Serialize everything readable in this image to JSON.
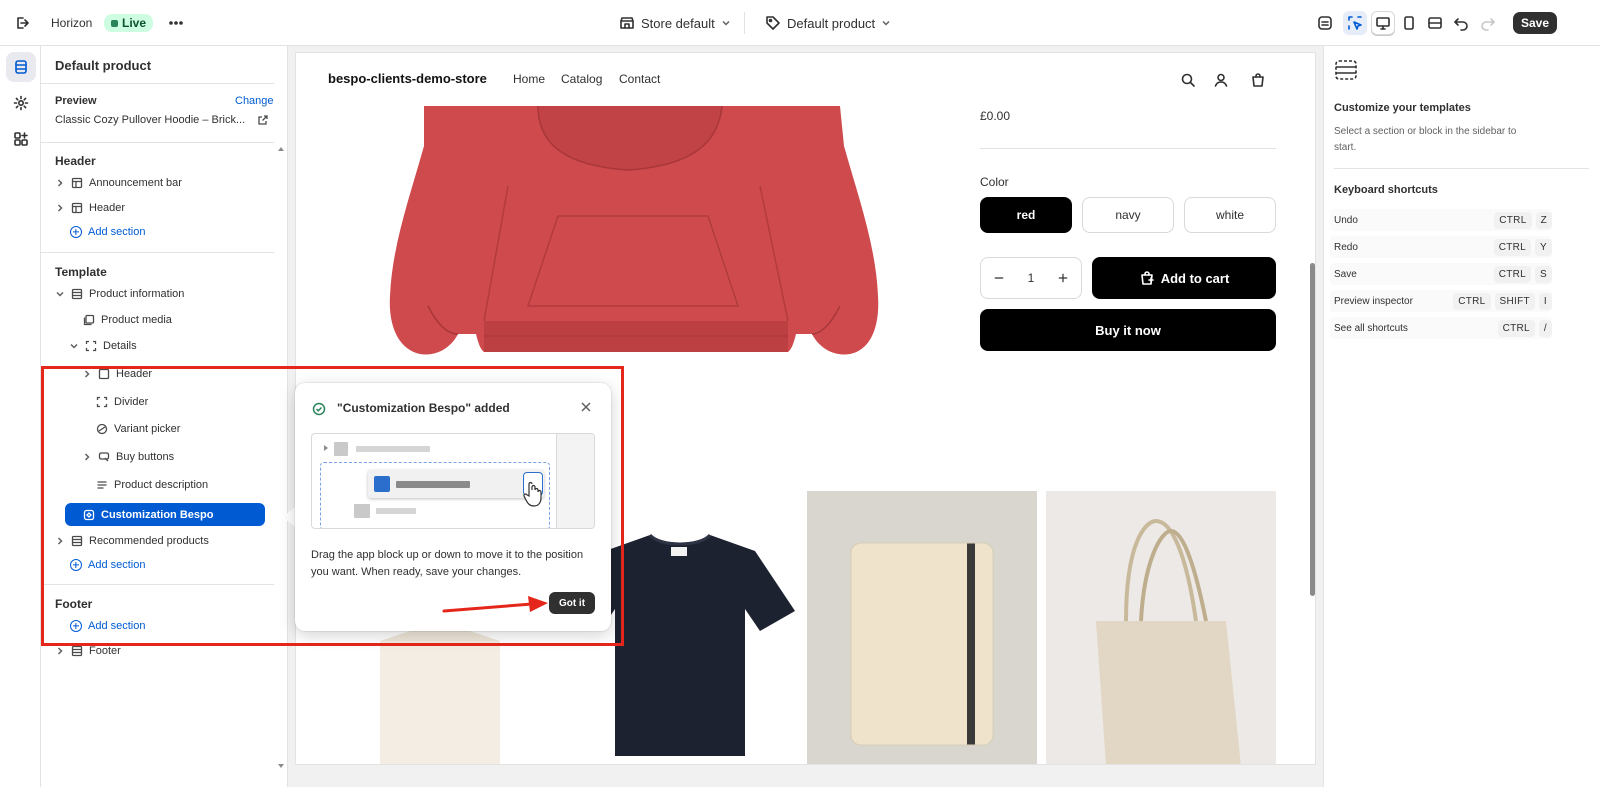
{
  "topbar": {
    "theme_name": "Horizon",
    "live_label": "Live",
    "store_selector": "Store default",
    "template_selector": "Default product",
    "save_label": "Save"
  },
  "sidebar": {
    "title": "Default product",
    "preview_label": "Preview",
    "change_label": "Change",
    "preview_product": "Classic Cozy Pullover Hoodie – Brick...",
    "header_group": "Header",
    "header_items": [
      "Announcement bar",
      "Header"
    ],
    "add_section": "Add section",
    "template_group": "Template",
    "product_information": "Product information",
    "product_media": "Product media",
    "details": "Details",
    "details_header": "Header",
    "divider": "Divider",
    "variant_picker": "Variant picker",
    "buy_buttons": "Buy buttons",
    "product_description": "Product description",
    "customization": "Customization Bespo",
    "recommended": "Recommended products",
    "footer_group": "Footer",
    "footer_item": "Footer"
  },
  "store": {
    "name": "bespo-clients-demo-store",
    "nav": [
      "Home",
      "Catalog",
      "Contact"
    ],
    "price": "£0.00",
    "color_label": "Color",
    "colors": [
      "red",
      "navy",
      "white"
    ],
    "selected_color": "red",
    "quantity": "1",
    "add_to_cart": "Add to cart",
    "buy_now": "Buy it now"
  },
  "popover": {
    "title": "\"Customization Bespo\" added",
    "text": "Drag the app block up or down to move it to the position you want. When ready, save your changes.",
    "button": "Got it"
  },
  "right_panel": {
    "title": "Customize your templates",
    "description": "Select a section or block in the sidebar to start.",
    "shortcuts_title": "Keyboard shortcuts",
    "shortcuts": [
      {
        "label": "Undo",
        "keys": [
          "CTRL",
          "Z"
        ]
      },
      {
        "label": "Redo",
        "keys": [
          "CTRL",
          "Y"
        ]
      },
      {
        "label": "Save",
        "keys": [
          "CTRL",
          "S"
        ]
      },
      {
        "label": "Preview inspector",
        "keys": [
          "CTRL",
          "SHIFT",
          "I"
        ]
      },
      {
        "label": "See all shortcuts",
        "keys": [
          "CTRL",
          "/"
        ]
      }
    ]
  },
  "colors": {
    "accent": "#005bd3",
    "live_bg": "#cdfee1",
    "annotation": "#e5271b",
    "hoodie": "#cf4a4c"
  }
}
